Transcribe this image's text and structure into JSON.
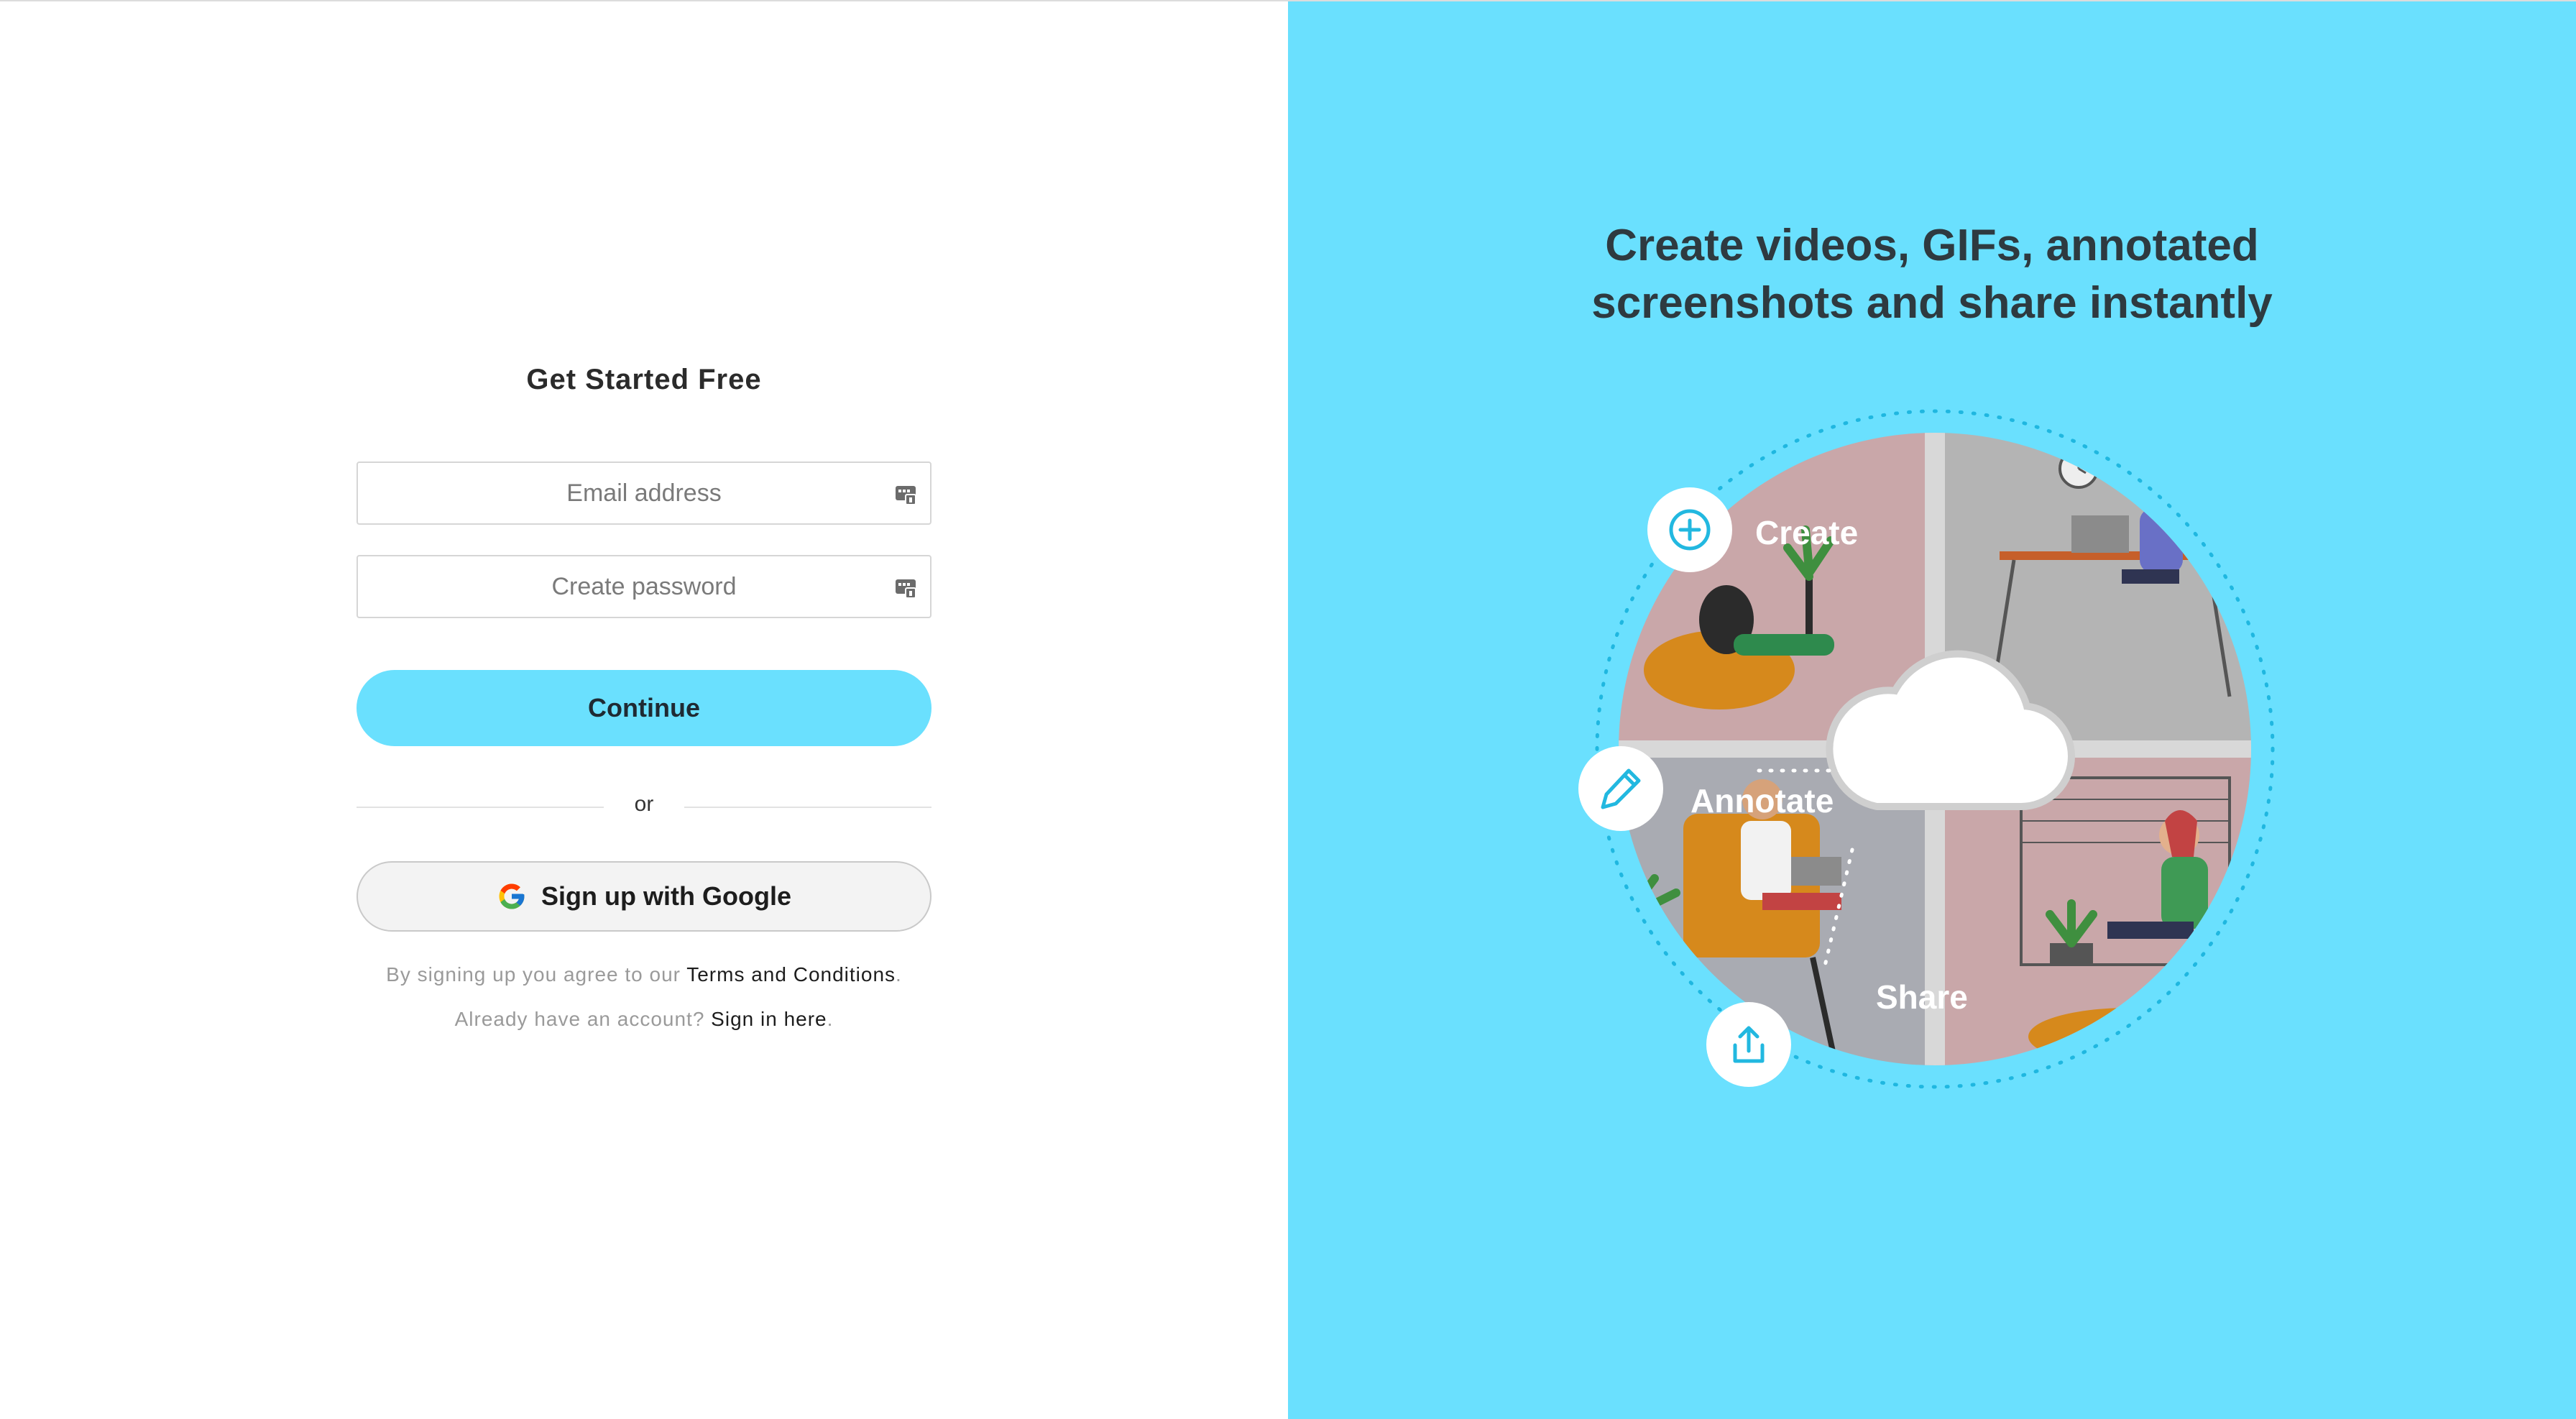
{
  "form": {
    "title": "Get Started Free",
    "email_placeholder": "Email address",
    "password_placeholder": "Create password",
    "continue_label": "Continue",
    "or_label": "or",
    "google_label": "Sign up with Google",
    "terms_prefix": "By signing up you agree to our ",
    "terms_link": "Terms and Conditions",
    "terms_suffix": ".",
    "signin_prefix": "Already have an account? ",
    "signin_link": "Sign in here",
    "signin_suffix": "."
  },
  "promo": {
    "headline_line1": "Create videos, GIFs, annotated",
    "headline_line2": "screenshots and share instantly",
    "features": {
      "create": "Create",
      "annotate": "Annotate",
      "share": "Share"
    }
  },
  "colors": {
    "accent": "#6ae0fe",
    "icon_blue": "#22b8e0",
    "text_dark": "#2e3a40"
  },
  "icons": {
    "password_manager": "password-manager-icon",
    "google": "google-g-icon",
    "create": "plus-circle-icon",
    "annotate": "pencil-icon",
    "share": "upload-share-icon",
    "cloud": "cloud-icon"
  }
}
